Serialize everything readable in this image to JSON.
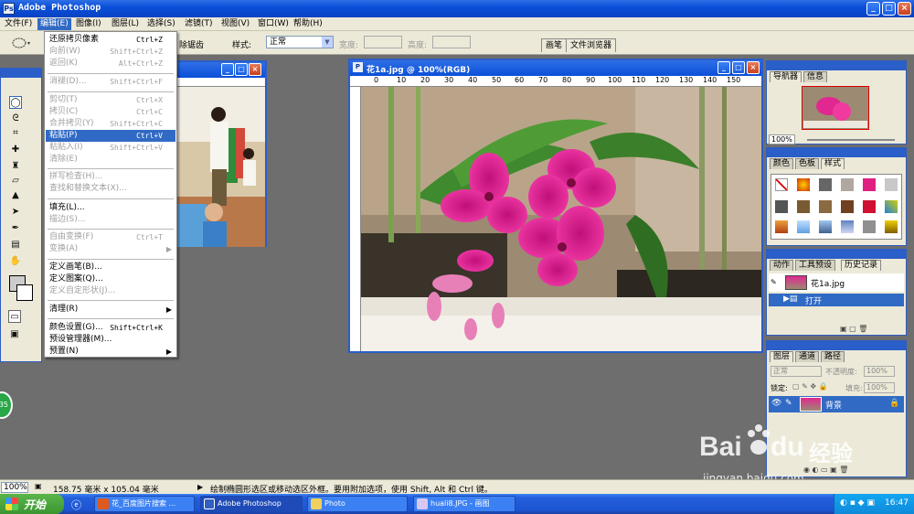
{
  "app": {
    "title": "Adobe Photoshop"
  },
  "menubar": [
    "文件(F)",
    "编辑(E)",
    "图像(I)",
    "图层(L)",
    "选择(S)",
    "滤镜(T)",
    "视图(V)",
    "窗口(W)",
    "帮助(H)"
  ],
  "options": {
    "partial_label": "除锯齿",
    "style_label": "样式:",
    "style_value": "正常",
    "width_label": "宽度:",
    "height_label": "高度:",
    "well_tabs": [
      "画笔",
      "文件浏览器"
    ]
  },
  "edit_menu": [
    {
      "label": "还原拷贝像素",
      "shortcut": "Ctrl+Z",
      "disabled": false
    },
    {
      "label": "向前(W)",
      "shortcut": "Shift+Ctrl+Z",
      "disabled": true
    },
    {
      "label": "返回(K)",
      "shortcut": "Alt+Ctrl+Z",
      "disabled": true
    },
    {
      "label": "消褪(D)...",
      "shortcut": "Shift+Ctrl+F",
      "disabled": true
    },
    {
      "label": "剪切(T)",
      "shortcut": "Ctrl+X",
      "disabled": true
    },
    {
      "label": "拷贝(C)",
      "shortcut": "Ctrl+C",
      "disabled": true
    },
    {
      "label": "合并拷贝(Y)",
      "shortcut": "Shift+Ctrl+C",
      "disabled": true
    },
    {
      "label": "粘贴(P)",
      "shortcut": "Ctrl+V",
      "disabled": false
    },
    {
      "label": "粘贴入(I)",
      "shortcut": "Shift+Ctrl+V",
      "disabled": true
    },
    {
      "label": "清除(E)",
      "shortcut": "",
      "disabled": true
    },
    {
      "label": "拼写检查(H)...",
      "shortcut": "",
      "disabled": true
    },
    {
      "label": "查找和替换文本(X)...",
      "shortcut": "",
      "disabled": true
    },
    {
      "label": "填充(L)...",
      "shortcut": "",
      "disabled": false
    },
    {
      "label": "描边(S)...",
      "shortcut": "",
      "disabled": true
    },
    {
      "label": "自由变换(F)",
      "shortcut": "Ctrl+T",
      "disabled": true
    },
    {
      "label": "变换(A)",
      "shortcut": "",
      "disabled": true
    },
    {
      "label": "定义画笔(B)...",
      "shortcut": "",
      "disabled": false
    },
    {
      "label": "定义图案(Q)...",
      "shortcut": "",
      "disabled": false
    },
    {
      "label": "定义自定形状(J)...",
      "shortcut": "",
      "disabled": true
    },
    {
      "label": "清理(R)",
      "shortcut": "",
      "disabled": false
    },
    {
      "label": "颜色设置(G)...",
      "shortcut": "Shift+Ctrl+K",
      "disabled": false
    },
    {
      "label": "预设管理器(M)...",
      "shortcut": "",
      "disabled": false
    },
    {
      "label": "预置(N)",
      "shortcut": "",
      "disabled": false
    }
  ],
  "document": {
    "title": "花1a.jpg @ 100%(RGB)",
    "ruler_ticks": [
      "0",
      "10",
      "20",
      "30",
      "40",
      "50",
      "60",
      "70",
      "80",
      "90",
      "100",
      "110",
      "120",
      "130",
      "140",
      "150"
    ]
  },
  "panels": {
    "navigator_tabs": [
      "导航器",
      "信息"
    ],
    "navigator_zoom": "100%",
    "swatches_tabs": [
      "颜色",
      "色板",
      "样式"
    ],
    "history_tabs": [
      "动作",
      "工具预设",
      "历史记录"
    ],
    "history_file": "花1a.jpg",
    "history_open": "打开",
    "layers_tabs": [
      "图层",
      "通道",
      "路径"
    ],
    "blend_mode": "正常",
    "opacity_label": "不透明度:",
    "opacity_value": "100%",
    "lock_label": "锁定:",
    "fill_label": "填充:",
    "fill_value": "100%",
    "layer_name": "背景"
  },
  "status": {
    "zoom": "100%",
    "size": "158.75 毫米 x 105.04 毫米",
    "hint": "绘制椭圆形选区或移动选区外框。要用附加选项，使用 Shift, Alt 和 Ctrl 键。"
  },
  "taskbar": {
    "start": "开始",
    "tasks": [
      "花_百度图片搜索 ...",
      "Adobe Photoshop",
      "Photo",
      "huali8.JPG - 画图"
    ],
    "clock": "16:47"
  },
  "watermark": {
    "brand": "Bai",
    "brand2": "du",
    "cn": "经验",
    "url": "jingyan.baidu.com"
  },
  "side_number": "35",
  "colors": {
    "accent": "#316ac5",
    "xp_title": "#0a4fd8"
  }
}
